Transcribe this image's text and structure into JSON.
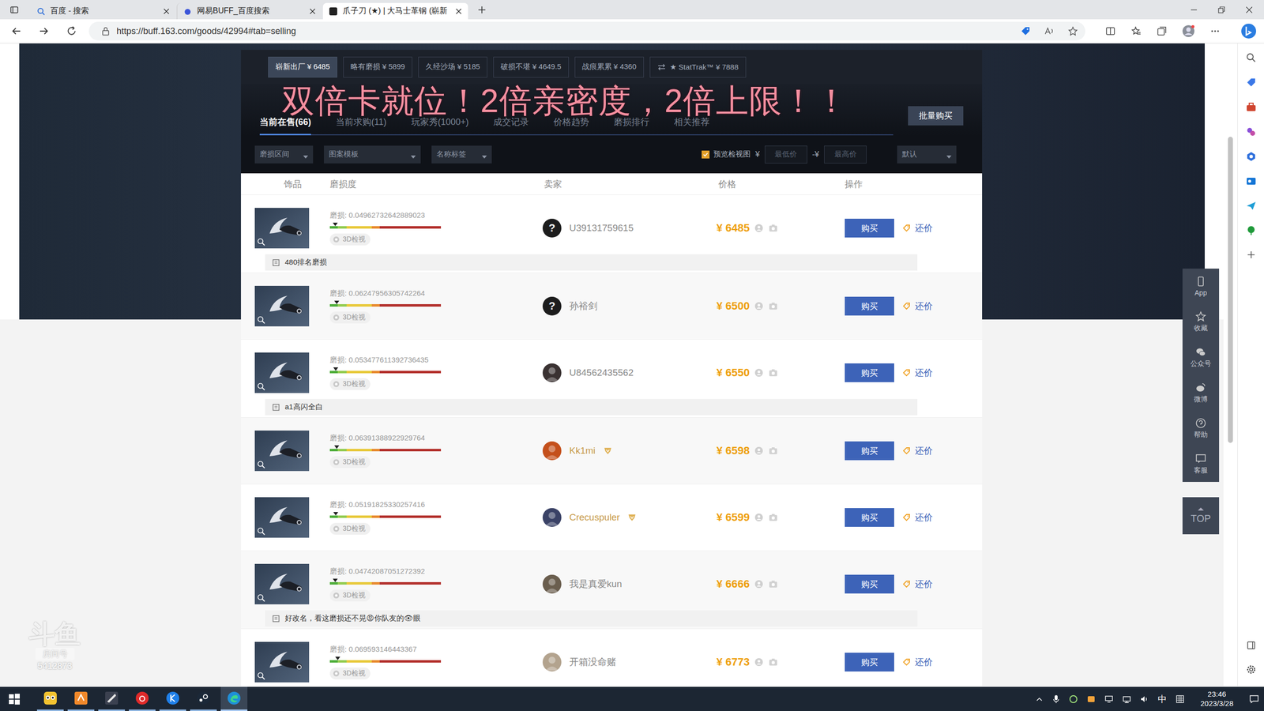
{
  "browser": {
    "tabs": [
      {
        "label": "百度 - 搜索",
        "selected": false
      },
      {
        "label": "网易BUFF_百度搜索",
        "selected": false
      },
      {
        "label": "爪子刀 (★) | 大马士革钢 (崭新",
        "selected": true
      }
    ],
    "address": "https://buff.163.com/goods/42994#tab=selling"
  },
  "wear_filters": [
    {
      "label": "崭新出厂 ¥ 6485",
      "selected": true
    },
    {
      "label": "略有磨损 ¥ 5899",
      "selected": false
    },
    {
      "label": "久经沙场 ¥ 5185",
      "selected": false
    },
    {
      "label": "破损不堪 ¥ 4649.5",
      "selected": false
    },
    {
      "label": "战痕累累 ¥ 4360",
      "selected": false
    },
    {
      "label": "★ StatTrak™ ¥ 7888",
      "selected": false
    }
  ],
  "overlay": "双倍卡就位！2倍亲密度，2倍上限！！",
  "tabs": [
    {
      "label": "当前在售(66)",
      "selected": true
    },
    {
      "label": "当前求购(11)",
      "selected": false
    },
    {
      "label": "玩家秀(1000+)",
      "selected": false
    },
    {
      "label": "成交记录",
      "selected": false
    },
    {
      "label": "价格趋势",
      "selected": false
    },
    {
      "label": "磨损排行",
      "selected": false
    },
    {
      "label": "相关推荐",
      "selected": false
    }
  ],
  "bulk_button": "批量购买",
  "filters": {
    "dropdowns": [
      "磨损区间",
      "图案模板",
      "名称标签"
    ],
    "preview": {
      "label": "预览检视图",
      "checked": true
    },
    "currency": "¥",
    "min_placeholder": "最低价",
    "range_sep": "-¥",
    "max_placeholder": "最高价",
    "sort": "默认"
  },
  "columns": [
    "饰品",
    "磨损度",
    "卖家",
    "价格",
    "操作"
  ],
  "rows": [
    {
      "wear_label": "磨损: 0.04962732642889023",
      "level": 0.0496,
      "inspect": "3D检视",
      "seller": "U39131759615",
      "kind": "unknown",
      "avatar": "?",
      "verified": false,
      "price": "¥ 6485",
      "buy": "购买",
      "counter": "还价",
      "note": "480排名磨损"
    },
    {
      "wear_label": "磨损: 0.06247956305742264",
      "level": 0.0625,
      "inspect": "3D检视",
      "seller": "孙裕剑",
      "kind": "unknown",
      "avatar": "?",
      "verified": false,
      "price": "¥ 6500",
      "buy": "购买",
      "counter": "还价"
    },
    {
      "wear_label": "磨损: 0.053477611392736435",
      "level": 0.0535,
      "inspect": "3D检视",
      "seller": "U84562435562",
      "kind": "photo",
      "color": "#3a3232",
      "verified": false,
      "price": "¥ 6550",
      "buy": "购买",
      "counter": "还价",
      "note": "a1高闪全白"
    },
    {
      "wear_label": "磨损: 0.06391388922929764",
      "level": 0.0639,
      "inspect": "3D检视",
      "seller": "Kk1mi",
      "kind": "photo",
      "color": "#c4501c",
      "verified": true,
      "price": "¥ 6598",
      "buy": "购买",
      "counter": "还价"
    },
    {
      "wear_label": "磨损: 0.05191825330257416",
      "level": 0.0519,
      "inspect": "3D检视",
      "seller": "Crecuspuler",
      "kind": "photo",
      "color": "#3a4266",
      "verified": true,
      "price": "¥ 6599",
      "buy": "购买",
      "counter": "还价"
    },
    {
      "wear_label": "磨损: 0.04742087051272392",
      "level": 0.0474,
      "inspect": "3D检视",
      "seller": "我是真爱kun",
      "kind": "photo",
      "color": "#6a5e4e",
      "verified": false,
      "price": "¥ 6666",
      "buy": "购买",
      "counter": "还价",
      "note": "好改名，看这磨损还不晃😡你队友的👁眼"
    },
    {
      "wear_label": "磨损: 0.069593146443367",
      "level": 0.0696,
      "inspect": "3D检视",
      "seller": "开箱没命赌",
      "kind": "photo",
      "color": "#b3a38e",
      "verified": false,
      "price": "¥ 6773",
      "buy": "购买",
      "counter": "还价"
    }
  ],
  "side_toolbar": [
    "App",
    "收藏",
    "公众号",
    "微博",
    "帮助",
    "客服"
  ],
  "top_button": "TOP",
  "watermark": {
    "logo": "斗鱼",
    "sub": "房间号",
    "number": "5412873"
  },
  "taskbar": {
    "ime": "中",
    "time": "23:46",
    "date": "2023/3/28"
  }
}
